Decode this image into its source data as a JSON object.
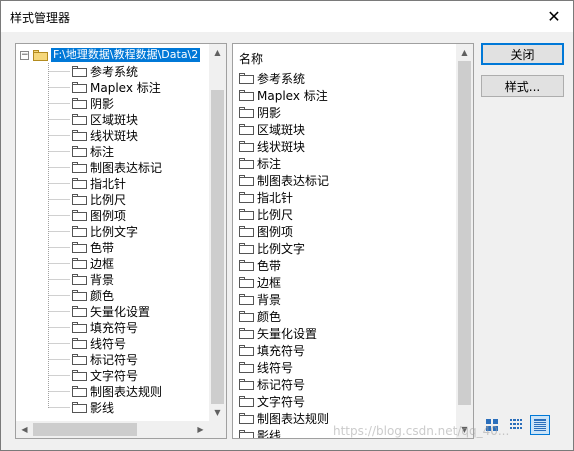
{
  "window": {
    "title": "样式管理器"
  },
  "tree": {
    "root_label": "F:\\地理数据\\教程数据\\Data\\2",
    "items": [
      "参考系统",
      "Maplex 标注",
      "阴影",
      "区域斑块",
      "线状斑块",
      "标注",
      "制图表达标记",
      "指北针",
      "比例尺",
      "图例项",
      "比例文字",
      "色带",
      "边框",
      "背景",
      "颜色",
      "矢量化设置",
      "填充符号",
      "线符号",
      "标记符号",
      "文字符号",
      "制图表达规则",
      "影线"
    ]
  },
  "list": {
    "column_header": "名称",
    "items": [
      "参考系统",
      "Maplex 标注",
      "阴影",
      "区域斑块",
      "线状斑块",
      "标注",
      "制图表达标记",
      "指北针",
      "比例尺",
      "图例项",
      "比例文字",
      "色带",
      "边框",
      "背景",
      "颜色",
      "矢量化设置",
      "填充符号",
      "线符号",
      "标记符号",
      "文字符号",
      "制图表达规则",
      "影线"
    ]
  },
  "buttons": {
    "close": "关闭",
    "styles": "样式..."
  },
  "watermark": "https://blog.csdn.net/qq_40..."
}
